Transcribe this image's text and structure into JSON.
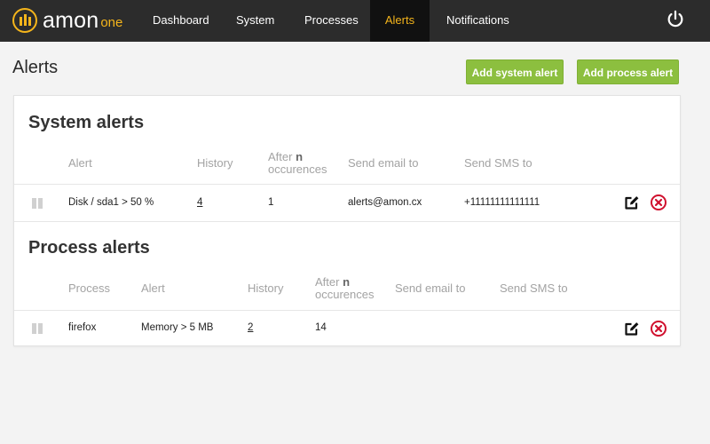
{
  "app": {
    "logo_text": "amon",
    "logo_sub": "one"
  },
  "nav": {
    "items": [
      {
        "label": "Dashboard"
      },
      {
        "label": "System"
      },
      {
        "label": "Processes"
      },
      {
        "label": "Alerts",
        "active": true
      },
      {
        "label": "Notifications"
      }
    ],
    "power_icon": "power-icon"
  },
  "page": {
    "title": "Alerts",
    "add_system_alert": "Add system alert",
    "add_process_alert": "Add process alert"
  },
  "system_alerts": {
    "title": "System alerts",
    "headers": {
      "alert": "Alert",
      "history": "History",
      "after_prefix": "After",
      "after_n": "n",
      "after_suffix": "occurences",
      "email": "Send email to",
      "sms": "Send SMS to"
    },
    "rows": [
      {
        "alert": "Disk / sda1 > 50 %",
        "history": "4",
        "after": "1",
        "email": "alerts@amon.cx",
        "sms": "+11111111111111"
      }
    ]
  },
  "process_alerts": {
    "title": "Process alerts",
    "headers": {
      "process": "Process",
      "alert": "Alert",
      "history": "History",
      "after_prefix": "After",
      "after_n": "n",
      "after_suffix": "occurences",
      "email": "Send email to",
      "sms": "Send SMS to"
    },
    "rows": [
      {
        "process": "firefox",
        "alert": "Memory > 5 MB",
        "history": "2",
        "after": "14",
        "email": "",
        "sms": ""
      }
    ]
  },
  "colors": {
    "nav_bg": "#2c2c2c",
    "nav_active_bg": "#111111",
    "accent": "#f5b51b",
    "button_green": "#8cbf3f",
    "delete_red": "#d0102e"
  },
  "icons": {
    "drag": "drag-handle-icon",
    "edit": "edit-icon",
    "delete": "delete-icon"
  }
}
